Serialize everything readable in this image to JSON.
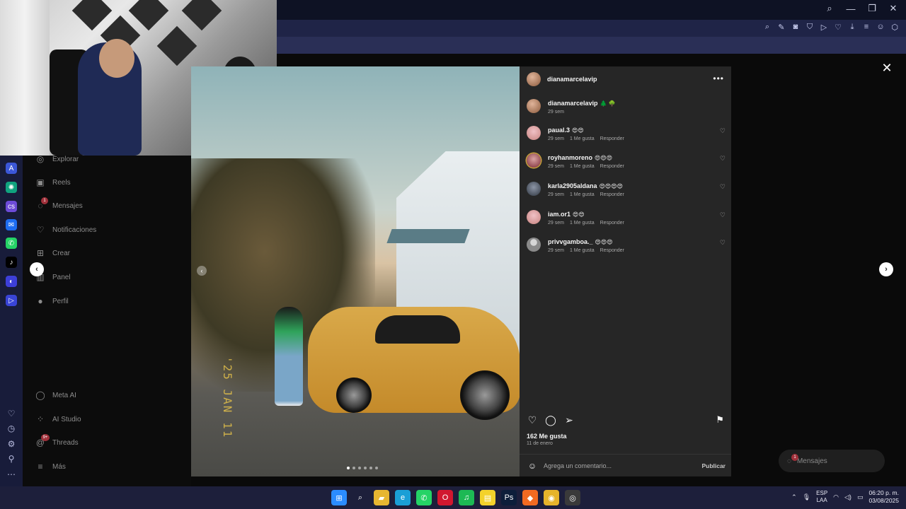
{
  "colors": {
    "panel_bg": "#262626",
    "text_primary": "#f5f5f5",
    "text_secondary": "#a8a8a8",
    "taskbar_bg": "#1d1f3b",
    "opera_red": "#d1182f"
  },
  "sidebar": {
    "items": [
      {
        "label": "Explorar",
        "icon": "compass-icon"
      },
      {
        "label": "Reels",
        "icon": "reels-icon"
      },
      {
        "label": "Mensajes",
        "icon": "messenger-icon"
      },
      {
        "label": "Notificaciones",
        "icon": "heart-icon"
      },
      {
        "label": "Crear",
        "icon": "plus-square-icon"
      },
      {
        "label": "Panel",
        "icon": "chart-icon"
      },
      {
        "label": "Perfil",
        "icon": "profile-icon"
      }
    ],
    "bottom_items": [
      {
        "label": "Meta AI",
        "icon": "meta-ai-icon"
      },
      {
        "label": "AI Studio",
        "icon": "ai-studio-icon"
      },
      {
        "label": "Threads",
        "icon": "threads-icon"
      },
      {
        "label": "Más",
        "icon": "menu-icon"
      }
    ],
    "messages_badge": "1",
    "threads_badge": "9+"
  },
  "post": {
    "author": "dianamarcelavip",
    "caption_author": "dianamarcelavip",
    "caption_emoji": "🌲 🌳",
    "caption_time": "29 sem",
    "stamp_text": "'25 JAN 11",
    "comments": [
      {
        "user": "paual.3",
        "text": "😍😍",
        "time": "29 sem",
        "likes": "1 Me gusta",
        "reply": "Responder",
        "avatar": "pink"
      },
      {
        "user": "royhanmoreno",
        "text": "😍😍😍",
        "time": "29 sem",
        "likes": "1 Me gusta",
        "reply": "Responder",
        "avatar": "red"
      },
      {
        "user": "karla2905aldana",
        "text": "😍😍😍😍",
        "time": "29 sem",
        "likes": "1 Me gusta",
        "reply": "Responder",
        "avatar": "dark"
      },
      {
        "user": "iam.or1",
        "text": "😍😍",
        "time": "29 sem",
        "likes": "1 Me gusta",
        "reply": "Responder",
        "avatar": "pink"
      },
      {
        "user": "privvgamboa._",
        "text": "😍😍😍",
        "time": "29 sem",
        "likes": "1 Me gusta",
        "reply": "Responder",
        "avatar": "grey"
      }
    ],
    "likes_count": "162 Me gusta",
    "date": "11 de enero",
    "comment_placeholder": "Agrega un comentario...",
    "publish_label": "Publicar"
  },
  "floating_messages": {
    "label": "Mensajes",
    "badge": "1"
  },
  "taskbar": {
    "apps": [
      {
        "name": "windows-start-icon",
        "glyph": "⊞",
        "color": "#2b8cff"
      },
      {
        "name": "search-icon",
        "glyph": "⌕",
        "color": "transparent"
      },
      {
        "name": "file-explorer-icon",
        "glyph": "▰",
        "color": "#e7b631"
      },
      {
        "name": "edge-icon",
        "glyph": "e",
        "color": "#1a9fd6"
      },
      {
        "name": "whatsapp-icon",
        "glyph": "✆",
        "color": "#25d366"
      },
      {
        "name": "opera-icon",
        "glyph": "O",
        "color": "#d1182f"
      },
      {
        "name": "spotify-icon",
        "glyph": "♫",
        "color": "#1db954"
      },
      {
        "name": "sticky-notes-icon",
        "glyph": "▤",
        "color": "#f3d22b"
      },
      {
        "name": "photoshop-icon",
        "glyph": "Ps",
        "color": "#0d1e3a"
      },
      {
        "name": "brave-icon",
        "glyph": "◆",
        "color": "#f26a21"
      },
      {
        "name": "chrome-icon",
        "glyph": "◉",
        "color": "#e6b42b"
      },
      {
        "name": "obs-icon",
        "glyph": "◎",
        "color": "#3a3a3a"
      }
    ],
    "lang_top": "ESP",
    "lang_bottom": "LAA",
    "time": "06:20 p. m.",
    "date": "03/08/2025"
  }
}
